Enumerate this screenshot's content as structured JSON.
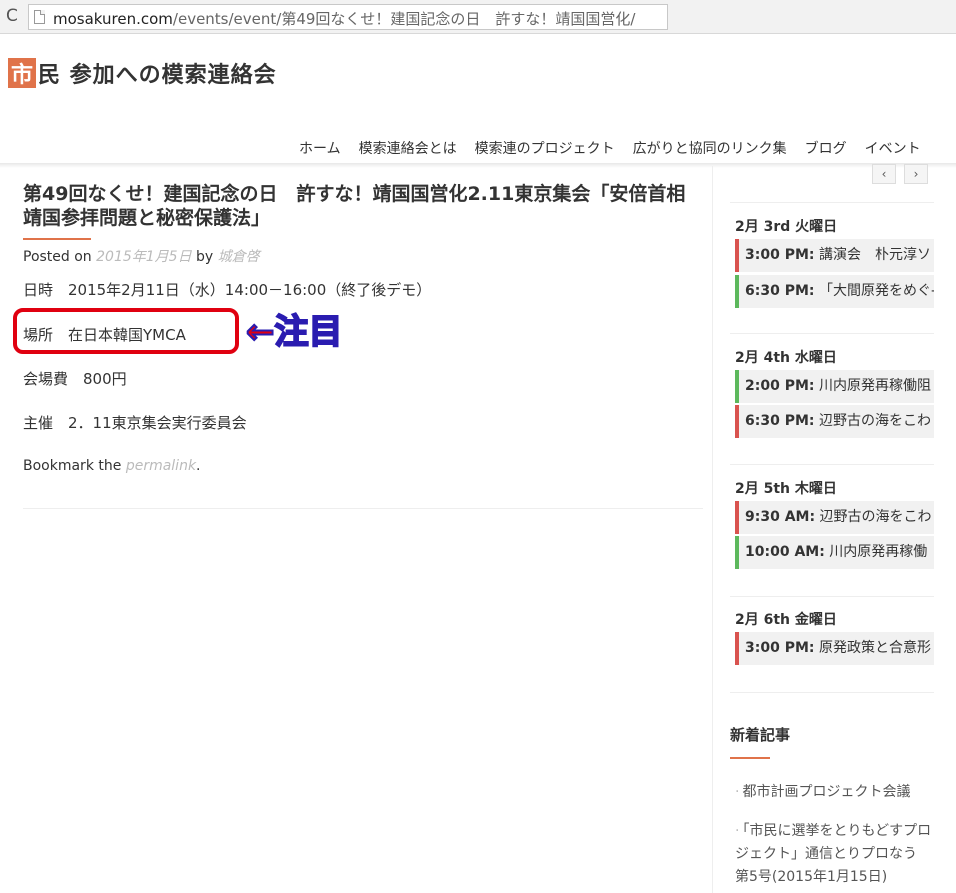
{
  "browser": {
    "url_host": "mosakuren.com",
    "url_path": "/events/event/第49回なくせ！建国記念の日　許すな！靖国国営化/"
  },
  "site": {
    "logo_char": "市",
    "logo_text": "民 参加への模索連絡会",
    "nav": [
      "ホーム",
      "模索連絡会とは",
      "模索連のプロジェクト",
      "広がりと協同のリンク集",
      "ブログ",
      "イベント"
    ]
  },
  "article": {
    "title": "第49回なくせ！建国記念の日　許すな！靖国国営化2.11東京集会「安倍首相靖国参拝問題と秘密保護法」",
    "posted_on": "Posted on",
    "date": "2015年1月5日",
    "by": "by",
    "author": "城倉啓",
    "lines": [
      "日時　2015年2月11日（水）14:00－16:00（終了後デモ）",
      "場所　在日本韓国YMCA",
      "会場費　800円",
      "主催　2．11東京集会実行委員会"
    ],
    "bookmark_prefix": "Bookmark the",
    "bookmark_link": "permalink",
    "bookmark_suffix": "."
  },
  "annotation": {
    "text": "←注目",
    "color": "#e00010"
  },
  "sidebar": {
    "cal_prev": "‹",
    "cal_next": "›",
    "days": [
      {
        "heading": "2月 3rd 火曜日",
        "events": [
          {
            "time": "3:00 PM:",
            "title": "講演会　朴元淳ソ",
            "color": "red"
          },
          {
            "time": "6:30 PM:",
            "title": "「大間原発をめぐ-",
            "color": "green"
          }
        ]
      },
      {
        "heading": "2月 4th 水曜日",
        "events": [
          {
            "time": "2:00 PM:",
            "title": "川内原発再稼働阻",
            "color": "green"
          },
          {
            "time": "6:30 PM:",
            "title": "辺野古の海をこわ",
            "color": "red"
          }
        ]
      },
      {
        "heading": "2月 5th 木曜日",
        "events": [
          {
            "time": "9:30 AM:",
            "title": "辺野古の海をこわ",
            "color": "red"
          },
          {
            "time": "10:00 AM:",
            "title": "川内原発再稼働",
            "color": "green"
          }
        ]
      },
      {
        "heading": "2月 6th 金曜日",
        "events": [
          {
            "time": "3:00 PM:",
            "title": "原発政策と合意形",
            "color": "red"
          }
        ]
      }
    ],
    "recent_title": "新着記事",
    "recent": [
      "都市計画プロジェクト会議",
      "「市民に選挙をとりもどすプロジェクト」通信とりプロなう　第5号(2015年1月15日)"
    ]
  }
}
